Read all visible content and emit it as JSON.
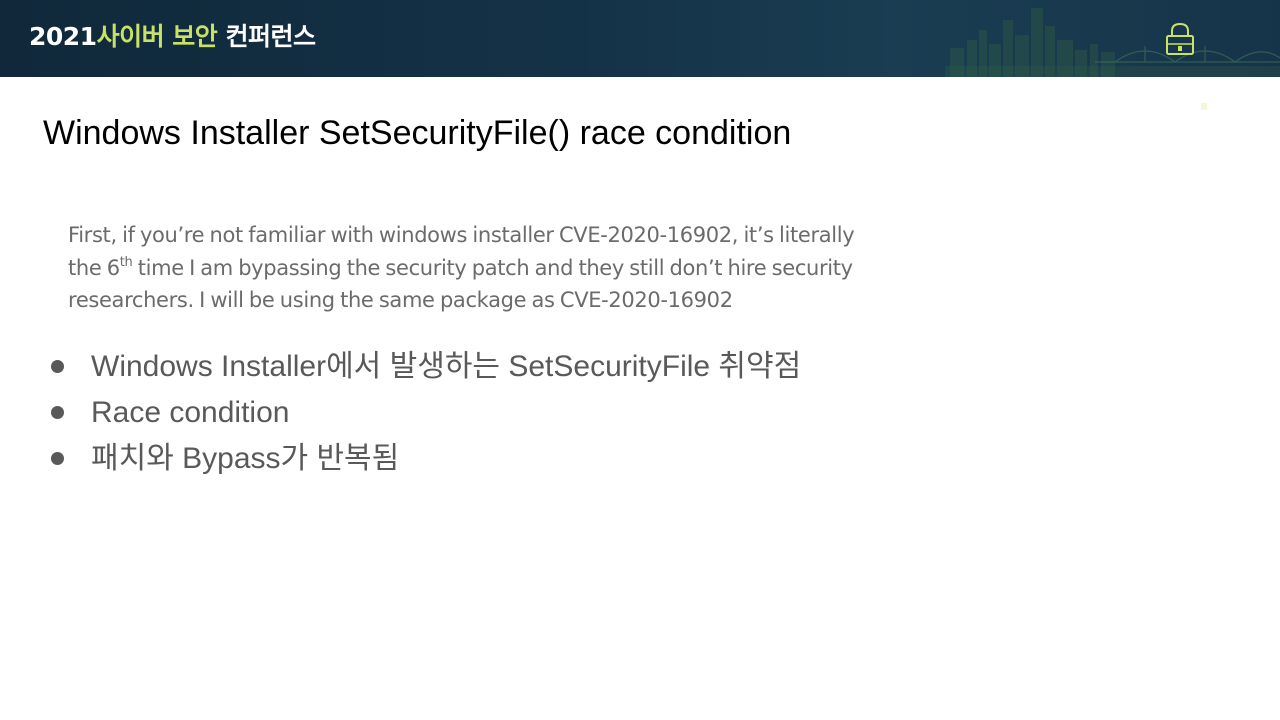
{
  "header": {
    "year": "2021",
    "title_highlight": "사이버 보안",
    "title_rest": "컨퍼런스",
    "lock_icon": "padlock-icon",
    "skyline_graphic": "city-skyline-bridge"
  },
  "slide": {
    "title": "Windows Installer SetSecurityFile() race condition",
    "quote": {
      "line1": "First, if you’re not familiar with windows installer CVE-2020-16902, it’s literally",
      "line2_before": "the 6",
      "line2_sup": "th",
      "line2_after": " time I am bypassing the security patch and they still don’t hire security",
      "line3": "researchers. I will be using the same package as CVE-2020-16902"
    },
    "bullets": [
      "Windows Installer에서 발생하는 SetSecurityFile 취약점",
      "Race condition",
      "패치와 Bypass가 반복됨"
    ]
  },
  "colors": {
    "header_bg": "#143247",
    "accent_green": "#c9e265",
    "title_text": "#000000",
    "body_text": "#595959",
    "quote_text": "#6b6b6b"
  }
}
